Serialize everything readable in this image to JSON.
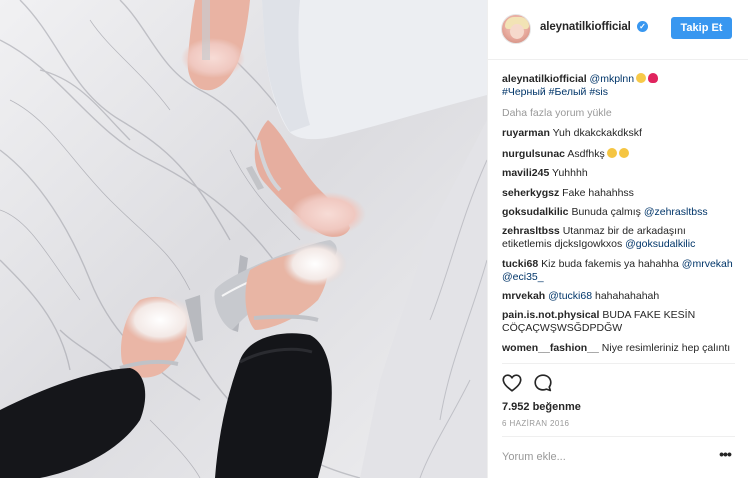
{
  "header": {
    "username": "aleynatilkiofficial",
    "follow_label": "Takip Et"
  },
  "caption": {
    "username": "aleynatilkiofficial",
    "mention": "@mkplnn",
    "hashtags": "#Черный #Белый #sis"
  },
  "load_more_label": "Daha fazla yorum yükle",
  "comments": [
    {
      "user": "ruyarman",
      "text": "Yuh dkakckakdkskf"
    },
    {
      "user": "nurgulsunac",
      "text": "Asdfhkş"
    },
    {
      "user": "mavili245",
      "text": "Yuhhhh"
    },
    {
      "user": "seherkygsz",
      "text": "Fake hahahhss"
    },
    {
      "user": "goksudalkilic",
      "text": "Bunuda çalmış",
      "mention": "@zehrasltbss"
    },
    {
      "user": "zehrasltbss",
      "text": "Utanmaz bir de arkadaşını etiketlemis djcksIgowkxos",
      "mention": "@goksudalkilic"
    },
    {
      "user": "tucki68",
      "text": "Kiz buda fakemis ya hahahha",
      "mention": "@mrvekah",
      "mention2": "@eci35_"
    },
    {
      "user": "mrvekah",
      "mention": "@tucki68",
      "text": "hahahahahah"
    },
    {
      "user": "pain.is.not.physical",
      "text": "BUDA FAKE KESİN CÖÇAÇWŞWSĞDPDĞW"
    },
    {
      "user": "women__fashion__",
      "text": "Niye resimleriniz hep çalıntı"
    }
  ],
  "likes_label": "7.952 beğenme",
  "date_label": "6 HAZİRAN 2016",
  "add_comment_placeholder": "Yorum ekle...",
  "more_options_label": "•••",
  "icons": {
    "verified": "verified-badge-icon",
    "like": "heart-icon",
    "comment": "comment-bubble-icon",
    "emoji_cat": "cat-face-emoji",
    "emoji_kiss": "kiss-mark-emoji",
    "emoji_cry": "crying-face-emoji"
  },
  "colors": {
    "accent": "#3897f0",
    "link": "#003569",
    "muted": "#999999",
    "text": "#262626"
  }
}
